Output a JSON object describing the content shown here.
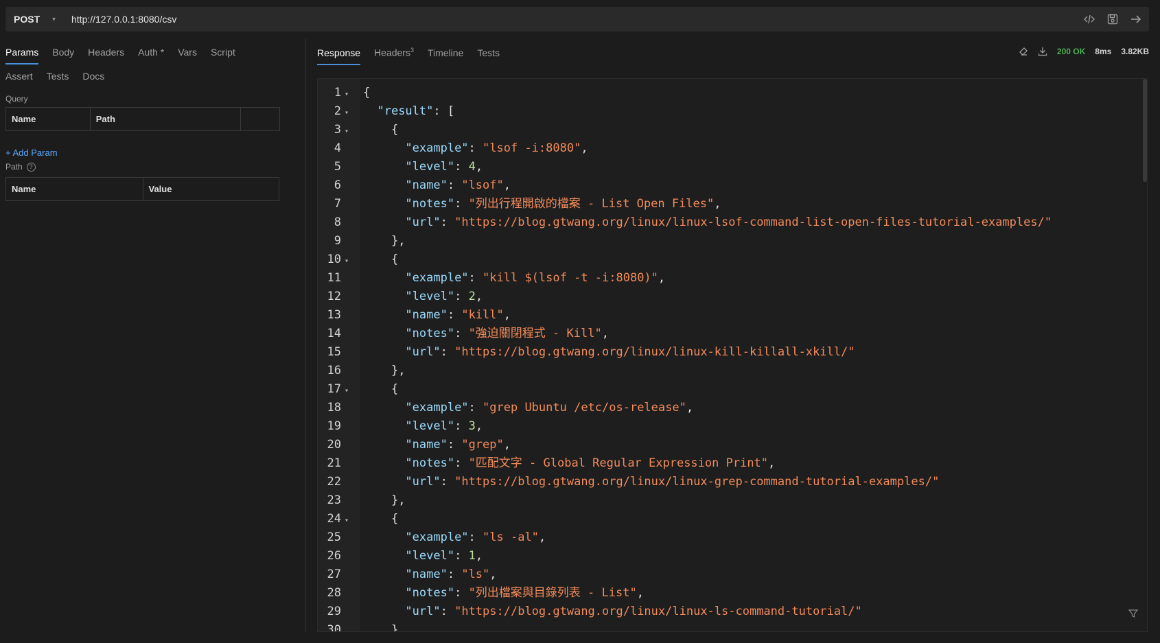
{
  "url_bar": {
    "method": "POST",
    "url": "http://127.0.0.1:8080/csv",
    "icons": [
      "code-icon",
      "save-icon",
      "send-arrow-icon"
    ]
  },
  "request": {
    "tabs_row1": [
      {
        "label": "Params",
        "active": true
      },
      {
        "label": "Body"
      },
      {
        "label": "Headers"
      },
      {
        "label": "Auth *"
      },
      {
        "label": "Vars"
      },
      {
        "label": "Script"
      }
    ],
    "tabs_row2": [
      {
        "label": "Assert"
      },
      {
        "label": "Tests"
      },
      {
        "label": "Docs"
      }
    ],
    "query": {
      "label": "Query",
      "columns": [
        "Name",
        "Path",
        ""
      ],
      "add_label": "+ Add Param"
    },
    "path": {
      "label": "Path",
      "columns": [
        "Name",
        "Value"
      ]
    }
  },
  "response": {
    "tabs": [
      {
        "label": "Response",
        "active": true
      },
      {
        "label": "Headers",
        "badge": "3"
      },
      {
        "label": "Timeline"
      },
      {
        "label": "Tests"
      }
    ],
    "status": "200 OK",
    "time": "8ms",
    "size": "3.82KB",
    "lines": [
      {
        "n": "1",
        "fold": true,
        "indent": 0,
        "t": [
          [
            "p",
            "{"
          ]
        ]
      },
      {
        "n": "2",
        "fold": true,
        "indent": 2,
        "t": [
          [
            "k",
            "\"result\""
          ],
          [
            "p",
            ": ["
          ]
        ]
      },
      {
        "n": "3",
        "fold": true,
        "indent": 4,
        "t": [
          [
            "p",
            "{"
          ]
        ]
      },
      {
        "n": "4",
        "indent": 6,
        "t": [
          [
            "k",
            "\"example\""
          ],
          [
            "p",
            ": "
          ],
          [
            "s",
            "\"lsof -i:8080\""
          ],
          [
            "p",
            ","
          ]
        ]
      },
      {
        "n": "5",
        "indent": 6,
        "t": [
          [
            "k",
            "\"level\""
          ],
          [
            "p",
            ": "
          ],
          [
            "n",
            "4"
          ],
          [
            "p",
            ","
          ]
        ]
      },
      {
        "n": "6",
        "indent": 6,
        "t": [
          [
            "k",
            "\"name\""
          ],
          [
            "p",
            ": "
          ],
          [
            "s",
            "\"lsof\""
          ],
          [
            "p",
            ","
          ]
        ]
      },
      {
        "n": "7",
        "indent": 6,
        "t": [
          [
            "k",
            "\"notes\""
          ],
          [
            "p",
            ": "
          ],
          [
            "s",
            "\"列出行程開啟的檔案 - List Open Files\""
          ],
          [
            "p",
            ","
          ]
        ]
      },
      {
        "n": "8",
        "indent": 6,
        "t": [
          [
            "k",
            "\"url\""
          ],
          [
            "p",
            ": "
          ],
          [
            "s",
            "\"https://blog.gtwang.org/linux/linux-lsof-command-list-open-files-tutorial-examples/\""
          ]
        ]
      },
      {
        "n": "9",
        "indent": 4,
        "t": [
          [
            "p",
            "},"
          ]
        ]
      },
      {
        "n": "10",
        "fold": true,
        "indent": 4,
        "t": [
          [
            "p",
            "{"
          ]
        ]
      },
      {
        "n": "11",
        "indent": 6,
        "t": [
          [
            "k",
            "\"example\""
          ],
          [
            "p",
            ": "
          ],
          [
            "s",
            "\"kill $(lsof -t -i:8080)\""
          ],
          [
            "p",
            ","
          ]
        ]
      },
      {
        "n": "12",
        "indent": 6,
        "t": [
          [
            "k",
            "\"level\""
          ],
          [
            "p",
            ": "
          ],
          [
            "n",
            "2"
          ],
          [
            "p",
            ","
          ]
        ]
      },
      {
        "n": "13",
        "indent": 6,
        "t": [
          [
            "k",
            "\"name\""
          ],
          [
            "p",
            ": "
          ],
          [
            "s",
            "\"kill\""
          ],
          [
            "p",
            ","
          ]
        ]
      },
      {
        "n": "14",
        "indent": 6,
        "t": [
          [
            "k",
            "\"notes\""
          ],
          [
            "p",
            ": "
          ],
          [
            "s",
            "\"強迫關閉程式 - Kill\""
          ],
          [
            "p",
            ","
          ]
        ]
      },
      {
        "n": "15",
        "indent": 6,
        "t": [
          [
            "k",
            "\"url\""
          ],
          [
            "p",
            ": "
          ],
          [
            "s",
            "\"https://blog.gtwang.org/linux/linux-kill-killall-xkill/\""
          ]
        ]
      },
      {
        "n": "16",
        "indent": 4,
        "t": [
          [
            "p",
            "},"
          ]
        ]
      },
      {
        "n": "17",
        "fold": true,
        "indent": 4,
        "t": [
          [
            "p",
            "{"
          ]
        ]
      },
      {
        "n": "18",
        "indent": 6,
        "t": [
          [
            "k",
            "\"example\""
          ],
          [
            "p",
            ": "
          ],
          [
            "s",
            "\"grep Ubuntu /etc/os-release\""
          ],
          [
            "p",
            ","
          ]
        ]
      },
      {
        "n": "19",
        "indent": 6,
        "t": [
          [
            "k",
            "\"level\""
          ],
          [
            "p",
            ": "
          ],
          [
            "n",
            "3"
          ],
          [
            "p",
            ","
          ]
        ]
      },
      {
        "n": "20",
        "indent": 6,
        "t": [
          [
            "k",
            "\"name\""
          ],
          [
            "p",
            ": "
          ],
          [
            "s",
            "\"grep\""
          ],
          [
            "p",
            ","
          ]
        ]
      },
      {
        "n": "21",
        "indent": 6,
        "t": [
          [
            "k",
            "\"notes\""
          ],
          [
            "p",
            ": "
          ],
          [
            "s",
            "\"匹配文字 - Global Regular Expression Print\""
          ],
          [
            "p",
            ","
          ]
        ]
      },
      {
        "n": "22",
        "indent": 6,
        "t": [
          [
            "k",
            "\"url\""
          ],
          [
            "p",
            ": "
          ],
          [
            "s",
            "\"https://blog.gtwang.org/linux/linux-grep-command-tutorial-examples/\""
          ]
        ]
      },
      {
        "n": "23",
        "indent": 4,
        "t": [
          [
            "p",
            "},"
          ]
        ]
      },
      {
        "n": "24",
        "fold": true,
        "indent": 4,
        "t": [
          [
            "p",
            "{"
          ]
        ]
      },
      {
        "n": "25",
        "indent": 6,
        "t": [
          [
            "k",
            "\"example\""
          ],
          [
            "p",
            ": "
          ],
          [
            "s",
            "\"ls -al\""
          ],
          [
            "p",
            ","
          ]
        ]
      },
      {
        "n": "26",
        "indent": 6,
        "t": [
          [
            "k",
            "\"level\""
          ],
          [
            "p",
            ": "
          ],
          [
            "n",
            "1"
          ],
          [
            "p",
            ","
          ]
        ]
      },
      {
        "n": "27",
        "indent": 6,
        "t": [
          [
            "k",
            "\"name\""
          ],
          [
            "p",
            ": "
          ],
          [
            "s",
            "\"ls\""
          ],
          [
            "p",
            ","
          ]
        ]
      },
      {
        "n": "28",
        "indent": 6,
        "t": [
          [
            "k",
            "\"notes\""
          ],
          [
            "p",
            ": "
          ],
          [
            "s",
            "\"列出檔案與目錄列表 - List\""
          ],
          [
            "p",
            ","
          ]
        ]
      },
      {
        "n": "29",
        "indent": 6,
        "t": [
          [
            "k",
            "\"url\""
          ],
          [
            "p",
            ": "
          ],
          [
            "s",
            "\"https://blog.gtwang.org/linux/linux-ls-command-tutorial/\""
          ]
        ]
      },
      {
        "n": "30",
        "indent": 4,
        "t": [
          [
            "p",
            "},"
          ]
        ]
      }
    ]
  },
  "colors": {
    "accent": "#4a90d9",
    "status_ok": "#4caf50",
    "json_key": "#9cdcfe",
    "json_string": "#f28b5b",
    "json_number": "#c0e0a0"
  }
}
